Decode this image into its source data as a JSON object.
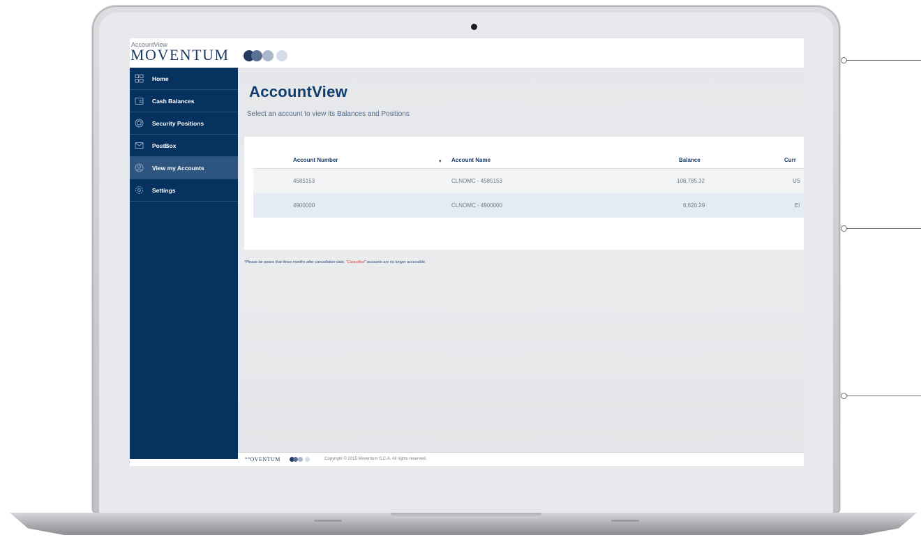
{
  "brand": {
    "app_name": "AccountView",
    "company": "MOVENTUM",
    "dot_colors": [
      "#1f3b63",
      "#5a6f94",
      "#a9b6cc",
      "#d5dcea"
    ]
  },
  "sidebar": {
    "items": [
      {
        "label": "Home",
        "icon": "grid-icon"
      },
      {
        "label": "Cash Balances",
        "icon": "wallet-icon"
      },
      {
        "label": "Security Positions",
        "icon": "gem-icon"
      },
      {
        "label": "PostBox",
        "icon": "envelope-icon"
      },
      {
        "label": "View my Accounts",
        "icon": "user-circle-icon",
        "active": true
      },
      {
        "label": "Settings",
        "icon": "gear-icon"
      }
    ]
  },
  "main": {
    "title": "AccountView",
    "subtitle": "Select an account to view its Balances and Positions"
  },
  "table": {
    "columns": [
      "Account Number",
      "Account Name",
      "Balance",
      "Curr"
    ],
    "rows": [
      {
        "number": "4585153",
        "name": "CLNOMC - 4585153",
        "balance": "108,785.32",
        "currency": "US"
      },
      {
        "number": "4900000",
        "name": "CLNOMC - 4900000",
        "balance": "6,620.29",
        "currency": "El"
      }
    ]
  },
  "footnote": {
    "before": "*Please be aware that three months after cancellation date, ",
    "highlight": "\"Cancelled\"",
    "after": " accounts are no longer accessible."
  },
  "footer": {
    "brand": "°°OVENTUM",
    "copyright": "Copyright © 2015 Moventum S.C.A. All rights reserved."
  },
  "colors": {
    "sidebar": "#06325f",
    "sidebar_active": "#2e5580",
    "title": "#0f3d6c",
    "footnote_highlight": "#d83a3a"
  }
}
